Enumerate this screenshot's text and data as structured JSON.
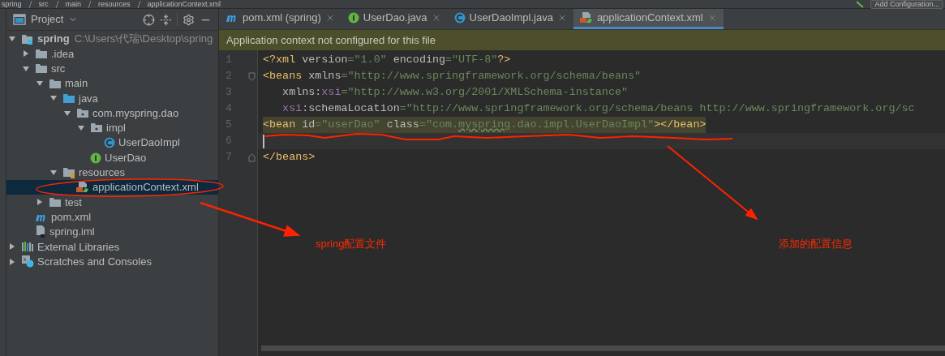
{
  "breadcrumb": {
    "items": [
      "spring",
      "src",
      "main",
      "resources",
      "applicationContext.xml"
    ]
  },
  "run_button": {
    "label": "Add Configuration..."
  },
  "project_panel": {
    "title": "Project",
    "tree": [
      {
        "label": "spring",
        "kind": "module",
        "path": "C:\\Users\\代瑞\\Desktop\\spring",
        "expanded": true,
        "selected": false,
        "children": [
          {
            "label": ".idea",
            "kind": "folder",
            "expanded": false,
            "selected": false
          },
          {
            "label": "src",
            "kind": "folder",
            "expanded": true,
            "selected": false,
            "children": [
              {
                "label": "main",
                "kind": "folder",
                "expanded": true,
                "selected": false,
                "children": [
                  {
                    "label": "java",
                    "kind": "source-folder",
                    "expanded": true,
                    "selected": false,
                    "children": [
                      {
                        "label": "com.myspring.dao",
                        "kind": "package",
                        "expanded": true,
                        "selected": false,
                        "children": [
                          {
                            "label": "impl",
                            "kind": "package",
                            "expanded": true,
                            "selected": false,
                            "children": [
                              {
                                "label": "UserDaoImpl",
                                "kind": "class",
                                "selected": false
                              }
                            ]
                          },
                          {
                            "label": "UserDao",
                            "kind": "interface",
                            "selected": false
                          }
                        ]
                      }
                    ]
                  },
                  {
                    "label": "resources",
                    "kind": "resources-folder",
                    "expanded": true,
                    "selected": false,
                    "children": [
                      {
                        "label": "applicationContext.xml",
                        "kind": "xml",
                        "selected": true
                      }
                    ]
                  }
                ]
              },
              {
                "label": "test",
                "kind": "folder",
                "expanded": false,
                "selected": false
              }
            ]
          },
          {
            "label": "pom.xml",
            "kind": "maven",
            "selected": false
          },
          {
            "label": "spring.iml",
            "kind": "iml",
            "selected": false
          }
        ]
      },
      {
        "label": "External Libraries",
        "kind": "libraries",
        "expanded": false,
        "selected": false
      },
      {
        "label": "Scratches and Consoles",
        "kind": "scratches",
        "expanded": false,
        "selected": false
      }
    ]
  },
  "tabs": [
    {
      "label": "pom.xml (spring)",
      "kind": "maven",
      "selected": false
    },
    {
      "label": "UserDao.java",
      "kind": "interface",
      "selected": false
    },
    {
      "label": "UserDaoImpl.java",
      "kind": "class",
      "selected": false
    },
    {
      "label": "applicationContext.xml",
      "kind": "xml",
      "selected": true
    }
  ],
  "banner": "Application context not configured for this file",
  "code_lines": [
    {
      "number": "1",
      "highlighted": false,
      "current": false,
      "tokens": [
        {
          "kind": "tag",
          "text": "<?xml"
        },
        {
          "kind": "attr",
          "text": " version"
        },
        {
          "kind": "value",
          "text": "=\"1.0\""
        },
        {
          "kind": "attr",
          "text": " encoding"
        },
        {
          "kind": "value",
          "text": "=\"UTF-8\""
        },
        {
          "kind": "tag",
          "text": "?>"
        }
      ]
    },
    {
      "number": "2",
      "highlighted": false,
      "current": false,
      "kind": "fold-start",
      "tokens": [
        {
          "kind": "tag",
          "text": "<beans"
        },
        {
          "kind": "attr",
          "text": " xmlns"
        },
        {
          "kind": "value",
          "text": "=\"http://www.springframework.org/schema/beans\""
        }
      ]
    },
    {
      "number": "3",
      "highlighted": false,
      "current": false,
      "tokens": [
        {
          "kind": "attr",
          "text": "   xmlns:"
        },
        {
          "kind": "ns",
          "text": "xsi"
        },
        {
          "kind": "value",
          "text": "=\"http://www.w3.org/2001/XMLSchema-instance\""
        }
      ]
    },
    {
      "number": "4",
      "highlighted": false,
      "current": false,
      "tokens": [
        {
          "kind": "ns",
          "text": "   xsi"
        },
        {
          "kind": "attr",
          "text": ":schemaLocation"
        },
        {
          "kind": "value",
          "text": "=\"http://www.springframework.org/schema/beans http://www.springframework.org/sc"
        }
      ]
    },
    {
      "number": "5",
      "highlighted": true,
      "current": false,
      "tokens": [
        {
          "kind": "tag",
          "text": "<bean"
        },
        {
          "kind": "attr",
          "text": " id"
        },
        {
          "kind": "value",
          "text": "=\"userDao\""
        },
        {
          "kind": "attr",
          "text": " class"
        },
        {
          "kind": "value",
          "text": "=\"com."
        },
        {
          "kind": "typo",
          "text": "myspring"
        },
        {
          "kind": "value",
          "text": ".dao.impl.UserDaoImpl\""
        },
        {
          "kind": "tag",
          "text": "></bean>"
        }
      ]
    },
    {
      "number": "6",
      "highlighted": false,
      "current": true
    },
    {
      "number": "7",
      "highlighted": false,
      "current": false,
      "kind": "fold-end",
      "tokens": [
        {
          "kind": "tag",
          "text": "</beans>"
        }
      ]
    }
  ],
  "annotations": [
    {
      "kind": "file-note",
      "text": "spring配置文件"
    },
    {
      "kind": "code-note",
      "text": "添加的配置信息"
    }
  ]
}
